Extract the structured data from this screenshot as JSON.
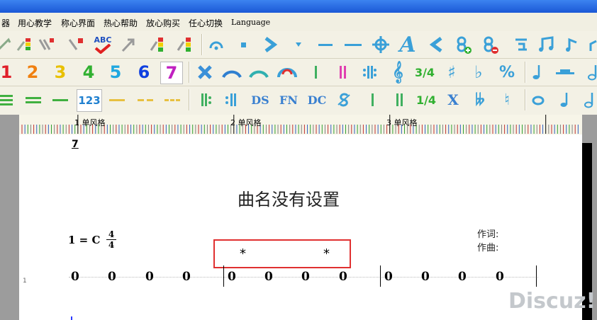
{
  "menu": [
    "器",
    "用心教学",
    "称心界面",
    "热心帮助",
    "放心购买",
    "任心切换",
    "Language"
  ],
  "toolbar_row2_digits": [
    "1",
    "2",
    "3",
    "4",
    "5",
    "6",
    "7"
  ],
  "toolbar_row2_colors": [
    "#e0202a",
    "#f08010",
    "#e8c000",
    "#30b030",
    "#20a8e0",
    "#1040e0",
    "#c020c0"
  ],
  "toolbar_text_labels": {
    "abc": "ABC",
    "dsg": "DS",
    "fn": "FN",
    "dc": "DC",
    "num123": "123",
    "x": "X",
    "time34": "3/4",
    "time14": "1/4"
  },
  "ruler_labels": [
    "1 单风格",
    "2 单风格",
    "3 单风格"
  ],
  "score": {
    "title": "曲名没有设置",
    "key": "1 = C",
    "time_top": "4",
    "time_bottom": "4",
    "lyricist": "作词:",
    "composer": "作曲:",
    "top_marker": "7",
    "line_number": "1",
    "notes": [
      "0",
      "0",
      "0",
      "0",
      "0",
      "0",
      "0",
      "0",
      "0",
      "0",
      "0",
      "0"
    ],
    "stars": [
      "*",
      "*"
    ]
  },
  "watermark": "Discuz!"
}
